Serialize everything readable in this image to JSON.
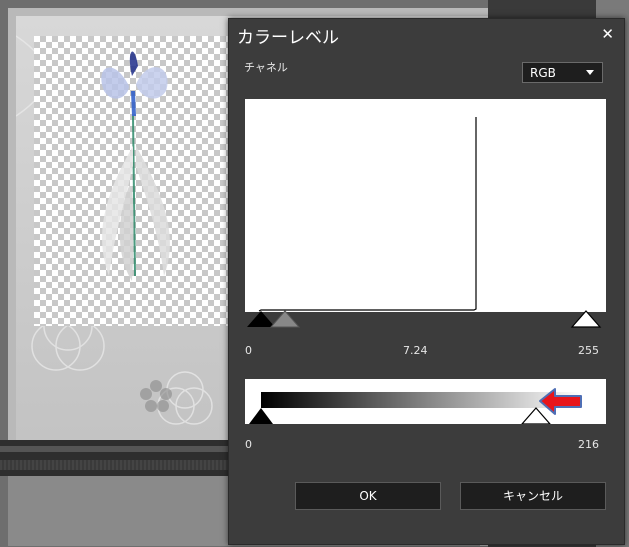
{
  "dialog": {
    "title": "カラーレベル",
    "close_icon": "close-icon",
    "channel_label": "チャネル",
    "channel_value": "RGB",
    "input_levels": {
      "black": "0",
      "gamma": "7.24",
      "white": "255"
    },
    "output_levels": {
      "black": "0",
      "white": "216"
    },
    "ok_label": "OK",
    "cancel_label": "キャンセル"
  },
  "colors": {
    "dialog_bg": "#3c3c3c",
    "annotation_arrow": "#e8151b",
    "annotation_outline": "#4f6fb5"
  }
}
